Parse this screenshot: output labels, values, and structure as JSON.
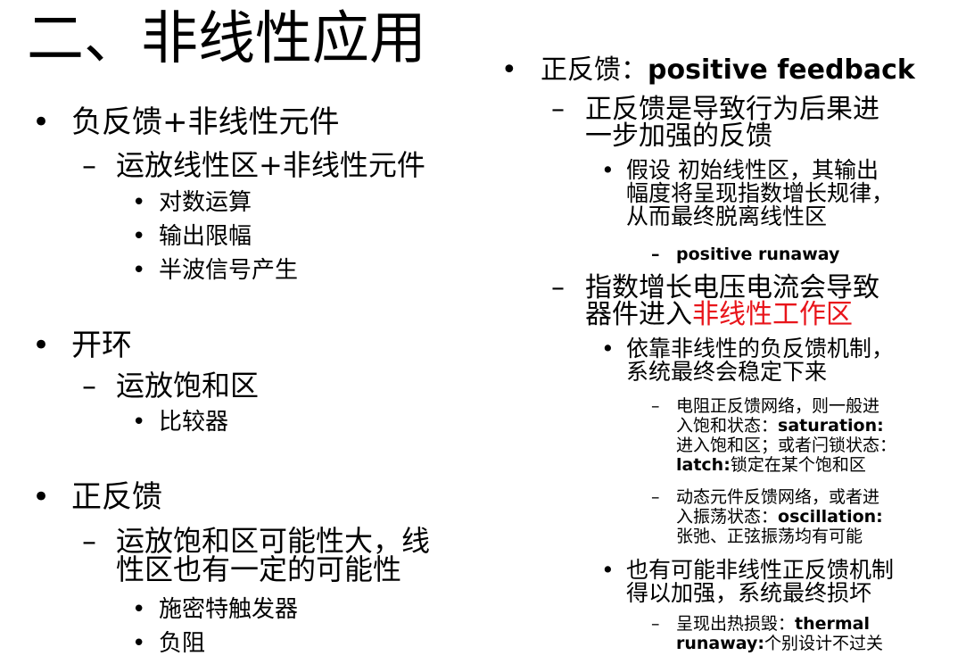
{
  "title": "二、非线性应用",
  "bullets": {
    "dot": "•",
    "dash": "–"
  },
  "left": {
    "s1": {
      "label": "负反馈+非线性元件",
      "sub": "运放线性区+非线性元件",
      "items": [
        "对数运算",
        "输出限幅",
        "半波信号产生"
      ]
    },
    "s2": {
      "label": "开环",
      "sub": "运放饱和区",
      "items": [
        "比较器"
      ]
    },
    "s3": {
      "label": "正反馈",
      "sub_l1": "运放饱和区可能性大，线",
      "sub_l2": "性区也有一定的可能性",
      "items": [
        "施密特触发器",
        "负阻"
      ]
    }
  },
  "right": {
    "head_cn": "正反馈：",
    "head_en": "positive feedback",
    "p1": {
      "l1": "正反馈是导致行为后果进",
      "l2": "一步加强的反馈"
    },
    "p1a": {
      "l1": "假设 初始线性区，其输出",
      "l2": "幅度将呈现指数增长规律，",
      "l3": "从而最终脱离线性区"
    },
    "p1a1": "positive runaway",
    "p2": {
      "l1": "指数增长电压电流会导致",
      "l2_pre": "器件进入",
      "l2_red": "非线性工作区"
    },
    "p2a": {
      "l1": "依靠非线性的负反馈机制，",
      "l2": "系统最终会稳定下来"
    },
    "p2a1": {
      "l1": "电阻正反馈网络，则一般进",
      "l2_pre": "入饱和状态：",
      "l2_en": "saturation:",
      "l3": "进入饱和区；或者闩锁状态：",
      "l4_en": "latch:",
      "l4_post": "锁定在某个饱和区"
    },
    "p2a2": {
      "l1": "动态元件反馈网络，或者进",
      "l2_pre": "入振荡状态：",
      "l2_en": "oscillation:",
      "l3": "张弛、正弦振荡均有可能"
    },
    "p2b": {
      "l1": "也有可能非线性正反馈机制",
      "l2": "得以加强，系统最终损坏"
    },
    "p2b1": {
      "l1_pre": "呈现出热损毁：",
      "l1_en": "thermal",
      "l2_en": "runaway:",
      "l2_post": "个别设计不过关"
    }
  }
}
